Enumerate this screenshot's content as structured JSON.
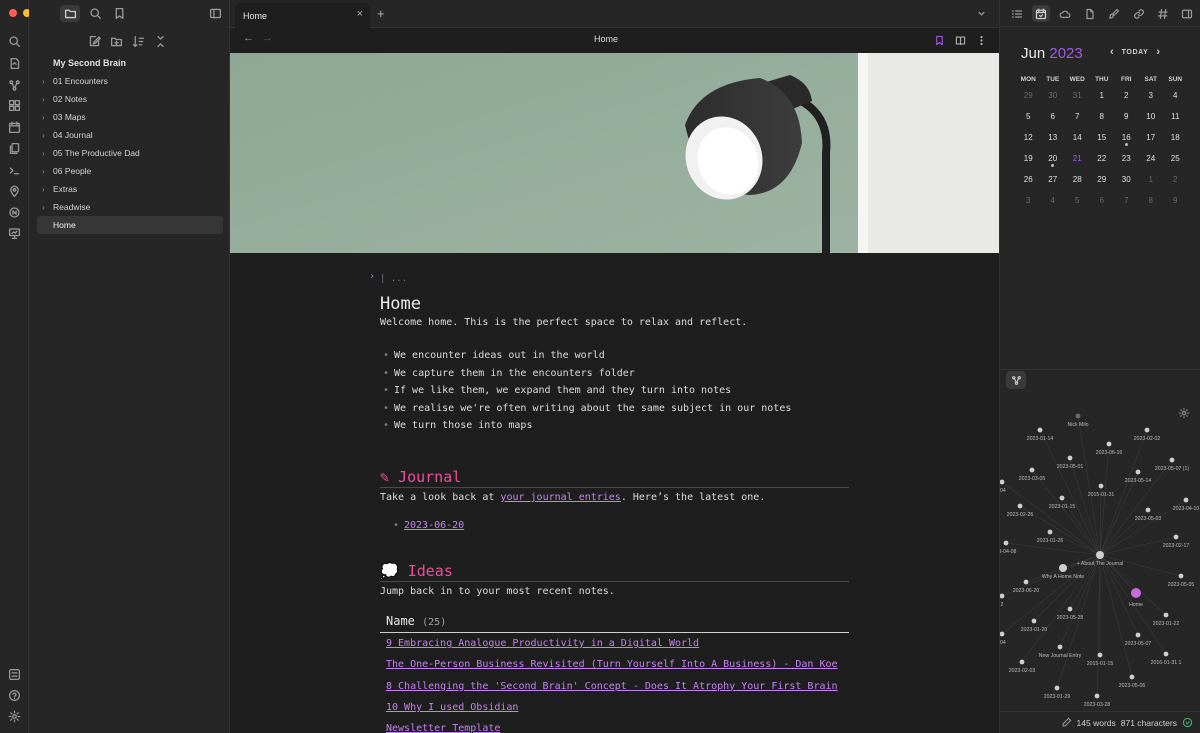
{
  "window": {
    "traffic_colors": [
      "#ff5f57",
      "#febc2e",
      "#28c840"
    ]
  },
  "explorer": {
    "vault_name": "My Second Brain",
    "items": [
      {
        "label": "01 Encounters",
        "folder": true
      },
      {
        "label": "02 Notes",
        "folder": true
      },
      {
        "label": "03 Maps",
        "folder": true
      },
      {
        "label": "04 Journal",
        "folder": true
      },
      {
        "label": "05 The Productive Dad",
        "folder": true
      },
      {
        "label": "06 People",
        "folder": true
      },
      {
        "label": "Extras",
        "folder": true
      },
      {
        "label": "Readwise",
        "folder": true
      },
      {
        "label": "Home",
        "folder": false,
        "active": true
      }
    ]
  },
  "tabs": {
    "active_tab": "Home",
    "close_glyph": "×",
    "new_tab_glyph": "+"
  },
  "nav": {
    "back": "←",
    "forward": "→",
    "title": "Home"
  },
  "note": {
    "properties_placeholder": "...",
    "title": "Home",
    "intro": "Welcome home. This is the perfect space to relax and reflect.",
    "bullets": [
      "We encounter ideas out in the world",
      "We capture them in the encounters folder",
      "If we like them, we expand them and they turn into notes",
      "We realise we're often writing about the same subject in our notes",
      "We turn those into maps"
    ],
    "journal": {
      "heading": "✎ Journal",
      "text_before": "Take a look back at ",
      "link": "your journal entries",
      "text_after": ". Here’s the latest one.",
      "latest": "2023-06-20"
    },
    "ideas": {
      "heading": "💭 Ideas",
      "text": "Jump back in to your most recent notes.",
      "column": "Name",
      "count": "(25)",
      "rows": [
        "9 Embracing Analogue Productivity in a Digital World",
        "The One-Person Business Revisited (Turn Yourself Into A Business) - Dan Koe",
        "8 Challenging the 'Second Brain' Concept - Does It Atrophy Your First Brain",
        "10 Why I used Obsidian",
        "Newsletter Template"
      ]
    }
  },
  "calendar": {
    "month": "Jun",
    "year": "2023",
    "today_label": "TODAY",
    "prev": "‹",
    "next": "›",
    "weekdays": [
      "MON",
      "TUE",
      "WED",
      "THU",
      "FRI",
      "SAT",
      "SUN"
    ],
    "weeks": [
      [
        {
          "d": "29",
          "dim": true
        },
        {
          "d": "30",
          "dim": true
        },
        {
          "d": "31",
          "dim": true
        },
        {
          "d": "1"
        },
        {
          "d": "2"
        },
        {
          "d": "3"
        },
        {
          "d": "4"
        }
      ],
      [
        {
          "d": "5"
        },
        {
          "d": "6"
        },
        {
          "d": "7"
        },
        {
          "d": "8"
        },
        {
          "d": "9"
        },
        {
          "d": "10"
        },
        {
          "d": "11"
        }
      ],
      [
        {
          "d": "12"
        },
        {
          "d": "13"
        },
        {
          "d": "14"
        },
        {
          "d": "15"
        },
        {
          "d": "16",
          "dot": true
        },
        {
          "d": "17"
        },
        {
          "d": "18"
        }
      ],
      [
        {
          "d": "19"
        },
        {
          "d": "20",
          "dot": true
        },
        {
          "d": "21",
          "today": true
        },
        {
          "d": "22"
        },
        {
          "d": "23"
        },
        {
          "d": "24"
        },
        {
          "d": "25"
        }
      ],
      [
        {
          "d": "26"
        },
        {
          "d": "27"
        },
        {
          "d": "28"
        },
        {
          "d": "29"
        },
        {
          "d": "30"
        },
        {
          "d": "1",
          "dim": true
        },
        {
          "d": "2",
          "dim": true
        }
      ],
      [
        {
          "d": "3",
          "dim": true
        },
        {
          "d": "4",
          "dim": true
        },
        {
          "d": "5",
          "dim": true
        },
        {
          "d": "6",
          "dim": true
        },
        {
          "d": "7",
          "dim": true
        },
        {
          "d": "8",
          "dim": true
        },
        {
          "d": "9",
          "dim": true
        }
      ]
    ]
  },
  "graph": {
    "nodes": [
      {
        "label": "Nick Milo",
        "dim": true
      },
      {
        "label": "2023-01-14"
      },
      {
        "label": "2023-02-02"
      },
      {
        "label": "2023-06-16"
      },
      {
        "label": "2023-05-01"
      },
      {
        "label": "2023-05-07 (1)"
      },
      {
        "label": "2023-03-05"
      },
      {
        "label": "2023-05-14"
      },
      {
        "label": "-04"
      },
      {
        "label": "2015-01-31"
      },
      {
        "label": "2023-01-15"
      },
      {
        "label": "2023-04-10"
      },
      {
        "label": "2023-02-26"
      },
      {
        "label": "2023-05-03"
      },
      {
        "label": "2023-01-26"
      },
      {
        "label": "2023-02-17"
      },
      {
        "label": "23-04-08"
      },
      {
        "label": "+ About The Journal",
        "hub": true
      },
      {
        "label": "Why A Home Note",
        "big": true
      },
      {
        "label": "2023-05-05"
      },
      {
        "label": "2023-06-20"
      },
      {
        "label": "Home",
        "home": true
      },
      {
        "label": "2"
      },
      {
        "label": "2023-05-28"
      },
      {
        "label": "2023-01-22"
      },
      {
        "label": "2023-01-20"
      },
      {
        "label": "2023-05-07"
      },
      {
        "label": "-04"
      },
      {
        "label": "New Journal Entry"
      },
      {
        "label": "2015-01-15"
      },
      {
        "label": "2016-01-31 1"
      },
      {
        "label": "2023-02-03"
      },
      {
        "label": "2023-05-06"
      },
      {
        "label": "2023-01-29"
      },
      {
        "label": "2023-03-28"
      }
    ]
  },
  "status": {
    "words": "145 words",
    "characters": "871 characters"
  }
}
